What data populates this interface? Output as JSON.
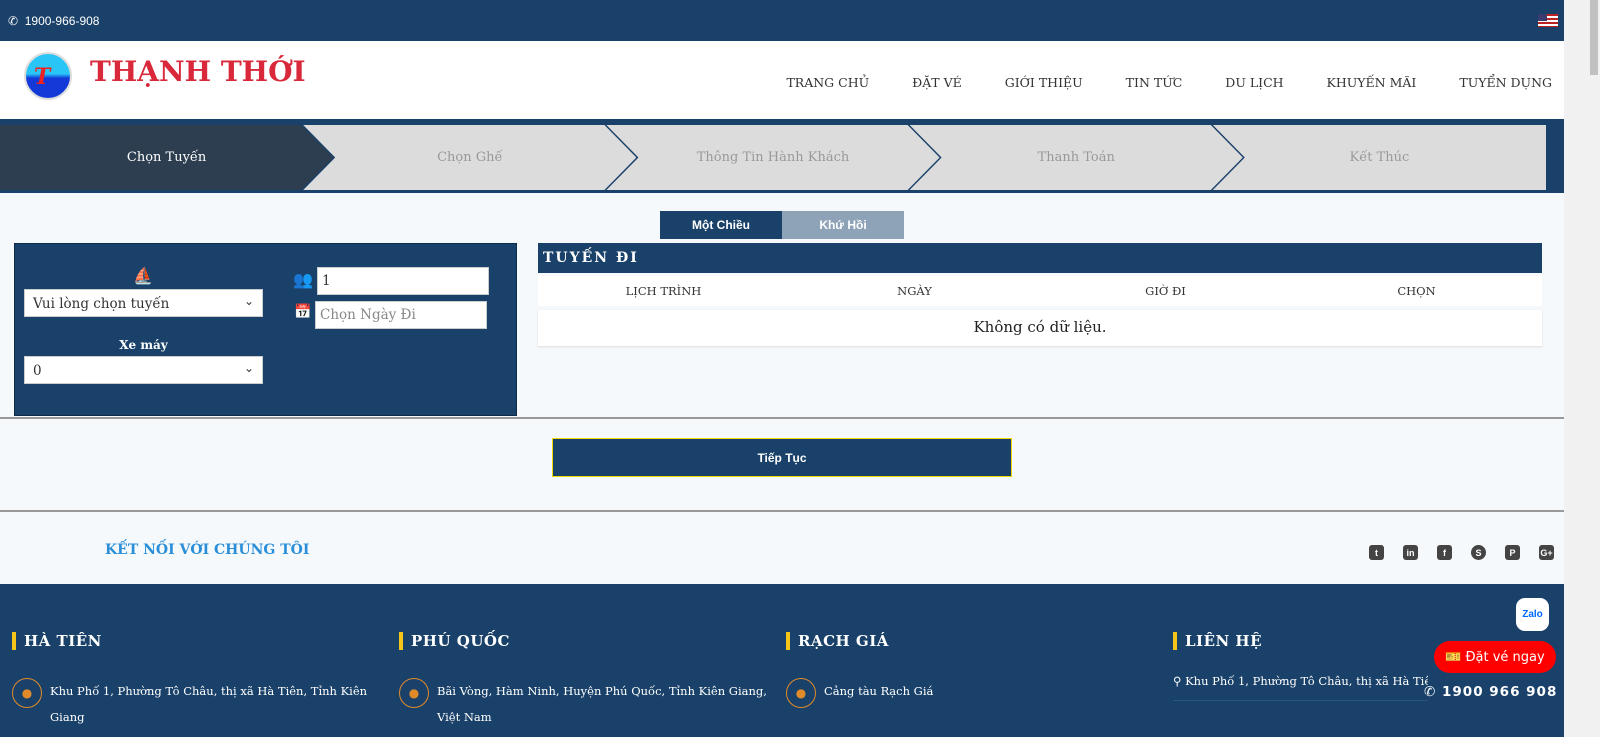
{
  "topbar": {
    "phone": "1900-966-908",
    "language_icon": "us-flag-icon"
  },
  "header": {
    "brand": "THẠNH THỚI",
    "nav": [
      "TRANG CHỦ",
      "ĐẶT VÉ",
      "GIỚI THIỆU",
      "TIN TỨC",
      "DU LỊCH",
      "KHUYẾN MÃI",
      "TUYỂN DỤNG"
    ]
  },
  "steps": [
    "Chọn Tuyến",
    "Chọn Ghế",
    "Thông Tin Hành Khách",
    "Thanh Toán",
    "Kết Thúc"
  ],
  "trip_tabs": {
    "one_way": "Một Chiều",
    "round_trip": "Khứ Hồi",
    "active": "one_way"
  },
  "form": {
    "route_select": "Vui lòng chọn tuyến",
    "motorbike_label": "Xe máy",
    "motorbike_value": "0",
    "passengers_value": "1",
    "date_placeholder": "Chọn Ngày Đi"
  },
  "results": {
    "title": "TUYẾN ĐI",
    "columns": [
      "LỊCH TRÌNH",
      "NGÀY",
      "GIỜ ĐI",
      "CHỌN"
    ],
    "empty": "Không có dữ liệu."
  },
  "continue_label": "Tiếp Tục",
  "connect_label": "KẾT NỐI VỚI CHÚNG TÔI",
  "social": [
    "twitter",
    "linkedin",
    "facebook",
    "skype",
    "pinterest",
    "google-plus"
  ],
  "footer": {
    "columns": [
      {
        "title": "HÀ TIÊN",
        "address": "Khu Phố 1, Phường Tô Châu, thị xã Hà Tiên, Tỉnh Kiên Giang"
      },
      {
        "title": "PHÚ QUỐC",
        "address": "Bãi Vòng, Hàm Ninh, Huyện Phú Quốc, Tỉnh Kiên Giang, Việt Nam"
      },
      {
        "title": "RẠCH GIÁ",
        "address": "Cảng tàu Rạch Giá"
      },
      {
        "title": "LIÊN HỆ",
        "address": "Khu Phố 1, Phường Tô Châu, thị xã Hà Tiên, Tỉnh Kiên Giang"
      }
    ]
  },
  "floating": {
    "zalo": "Zalo",
    "book_now": "Đặt vé ngay",
    "hotline": "1900 966 908"
  },
  "colors": {
    "primary": "#1a4169",
    "active_step": "#2c3e50",
    "brand_red": "#d8283a",
    "accent_yellow": "#f5c518",
    "book_red": "#ff0000"
  }
}
